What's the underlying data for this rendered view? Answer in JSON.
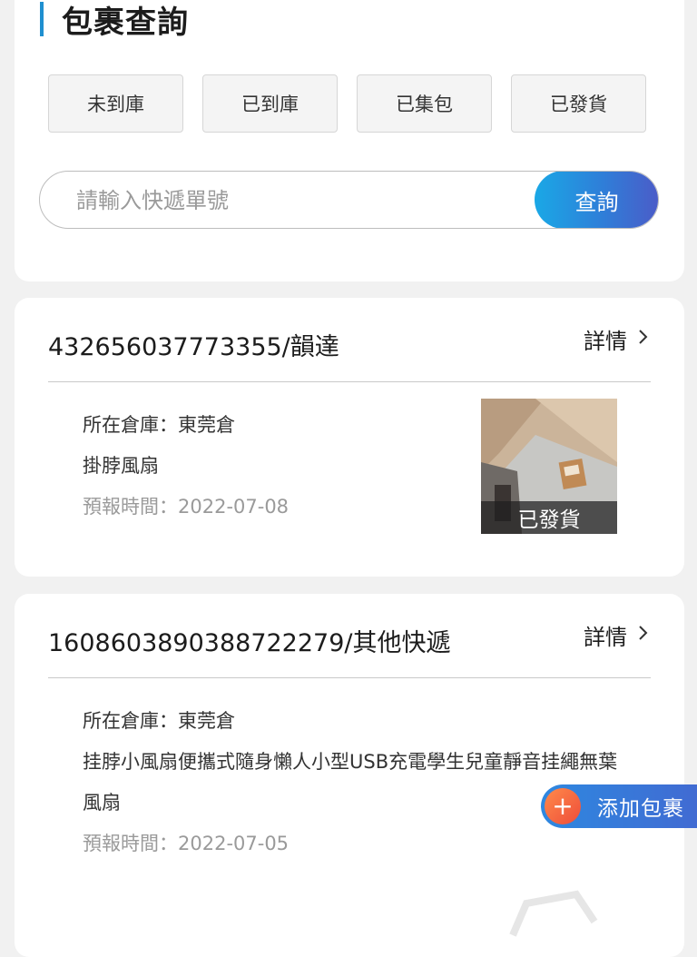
{
  "header": {
    "title": "包裹查詢"
  },
  "status_tabs": [
    "未到庫",
    "已到庫",
    "已集包",
    "已發貨"
  ],
  "search": {
    "placeholder": "請輸入快遞單號",
    "button_label": "查詢"
  },
  "parcels": [
    {
      "tracking": "432656037773355/韻達",
      "details_label": "詳情",
      "warehouse_label": "所在倉庫：",
      "warehouse": "東莞倉",
      "item_name": "掛脖風扇",
      "forecast_label": "預報時間：",
      "forecast_time": "2022-07-08",
      "thumbnail_status": "已發貨"
    },
    {
      "tracking": "16086038903887222​79/其他快遞",
      "details_label": "詳情",
      "warehouse_label": "所在倉庫：",
      "warehouse": "東莞倉",
      "item_name": "挂脖小風扇便攜式隨身懶人小型USB充電學生兒童靜音挂繩無葉風扇",
      "forecast_label": "預報時間：",
      "forecast_time": "2022-07-05"
    }
  ],
  "add_button": {
    "label": "添加包裹",
    "icon": "plus-icon"
  },
  "colors": {
    "accent": "#1f8fd0",
    "button_start": "#1aa8e6",
    "button_end": "#4b5cc8",
    "fab_plus": "#ee4d3a"
  }
}
